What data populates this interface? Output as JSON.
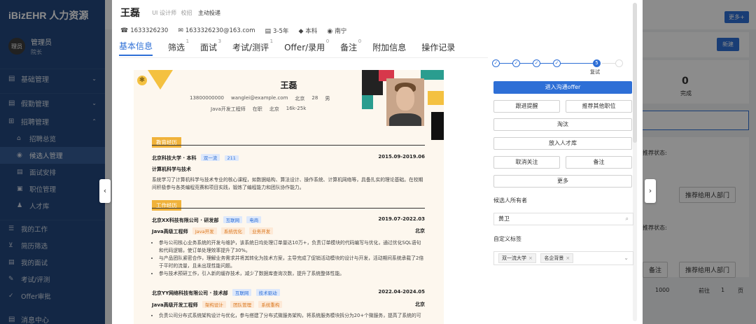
{
  "sidebar": {
    "brand": "iBizEHR 人力资源",
    "user": {
      "avatar": "理员",
      "name": "管理员",
      "role": "院长"
    },
    "groups": [
      {
        "label": "基础管理",
        "icon": "▤"
      },
      {
        "label": "假勤管理",
        "icon": "▤"
      },
      {
        "label": "招聘管理",
        "icon": "⊞"
      }
    ],
    "items": [
      {
        "label": "招聘总览",
        "icon": "⌂"
      },
      {
        "label": "候选人管理",
        "icon": "◉"
      },
      {
        "label": "面试安排",
        "icon": "▤"
      },
      {
        "label": "职位管理",
        "icon": "▣"
      },
      {
        "label": "人才库",
        "icon": "♟"
      }
    ],
    "items2": [
      {
        "label": "我的工作",
        "icon": "☰"
      },
      {
        "label": "简历筛选",
        "icon": "⊻"
      },
      {
        "label": "我的面试",
        "icon": "▤"
      },
      {
        "label": "考试/评测",
        "icon": "✎"
      },
      {
        "label": "Offer审批",
        "icon": "✓"
      }
    ],
    "bottom": {
      "label": "消息中心",
      "icon": "▤"
    }
  },
  "background": {
    "more_btn": "更多+",
    "new_btn": "新建",
    "stat_value": "0",
    "stat_label": "完成",
    "recommend_status_1": "推荐状态:",
    "recommend_status_2": "推荐状态:",
    "recommend_btn_1": "推荐给用人部门",
    "recommend_btn_2": "推荐给用人部门",
    "note_btn": "备注",
    "page_size": "1000",
    "goto": "前往",
    "page_num": "1",
    "page_unit": "页"
  },
  "header": {
    "name": "王磊",
    "position": "UI 设计师",
    "source_label": "校招",
    "source_value": "主动投递",
    "contacts": [
      {
        "icon": "☎",
        "text": "1633326230"
      },
      {
        "icon": "✉",
        "text": "1633326230@163.com"
      },
      {
        "icon": "▤",
        "text": "3-5年"
      },
      {
        "icon": "◆",
        "text": "本科"
      },
      {
        "icon": "◉",
        "text": "南宁"
      }
    ]
  },
  "tabs": [
    {
      "label": "基本信息",
      "count": ""
    },
    {
      "label": "筛选",
      "count": "1"
    },
    {
      "label": "面试",
      "count": "3"
    },
    {
      "label": "考试/测评",
      "count": "1"
    },
    {
      "label": "Offer/录用",
      "count": "0"
    },
    {
      "label": "备注",
      "count": "0"
    },
    {
      "label": "附加信息",
      "count": ""
    },
    {
      "label": "操作记录",
      "count": ""
    }
  ],
  "resume": {
    "name": "王磊",
    "phone": "13800000000",
    "email": "wanglei@example.com",
    "city": "北京",
    "age": "28",
    "gender": "男",
    "job": "Java开发工程师",
    "status": "在职",
    "target_city": "北京",
    "salary": "16k-25k",
    "edu_title": "教育经历",
    "edu_school": "北京科技大学 · 本科",
    "edu_tags": [
      "双一流",
      "211"
    ],
    "edu_date": "2015.09-2019.06",
    "edu_major": "计算机科学与技术",
    "edu_desc": "系统学习了计算机科学与技术专业的核心课程，如数据结构、算法设计、操作系统、计算机网络等，具备扎实的理论基础。在校期间积极参与各类编程竞赛和项目实践，锻炼了编程能力和团队协作能力。",
    "work_title": "工作经历",
    "job1_company": "北京XX科技有限公司 · 研发部",
    "job1_tags": [
      "互联网",
      "电商"
    ],
    "job1_date": "2019.07-2022.03",
    "job1_role": "Java高级工程师",
    "job1_role_tags": [
      "Java开发",
      "系统优化",
      "业务开发"
    ],
    "job1_loc": "北京",
    "job1_bullets": [
      "参与公司核心业务系统的开发与维护，该系统日均处理订单量达10万+，负责订单模块的代码编写与优化，通过优化SQL语句和代码逻辑，使订单处理效率提升了30%。",
      "与产品团队紧密合作，理解业务需求并将其转化为技术方案，主导完成了促销活动模块的设计与开发，活动期间系统承载了2倍于平时的流量，且未出现性能问题。",
      "参与技术预研工作，引入新的缓存技术，减少了数据库查询次数，提升了系统整体性能。"
    ],
    "job2_company": "北京YY网络科技有限公司 · 技术部",
    "job2_tags": [
      "互联网",
      "技术驱动"
    ],
    "job2_date": "2022.04-2024.05",
    "job2_role": "Java高级开发工程师",
    "job2_role_tags": [
      "架构设计",
      "团队管理",
      "系统重构"
    ],
    "job2_loc": "北京",
    "job2_bullets": [
      "负责公司分布式系统架构设计与优化，参与搭建了分布式微服务架构，将系统服务模块拆分为20+个微服务，提高了系统的可"
    ]
  },
  "panel": {
    "steps": [
      "✓",
      "✓",
      "✓",
      "✓",
      "5",
      ""
    ],
    "current_step_label": "复试",
    "primary_action": "进入沟通offer",
    "actions": [
      [
        "跟进提醒",
        "推荐其他职位"
      ],
      [
        "淘汰"
      ],
      [
        "放入人才库"
      ],
      [
        "取消关注",
        "备注"
      ],
      [
        "更多"
      ]
    ],
    "owner_label": "候选人所有者",
    "owner_value": "黄卫",
    "tags_label": "自定义标签",
    "tags": [
      "双一流大学",
      "名企背景"
    ]
  },
  "colors": {
    "primary": "#2e6fd6",
    "sidebar": "#23487f",
    "accent_yellow": "#f0b23a"
  }
}
